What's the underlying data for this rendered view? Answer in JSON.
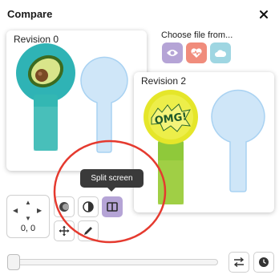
{
  "window": {
    "title": "Compare",
    "close_icon": "close-icon"
  },
  "revisions": [
    {
      "label": "Revision 0"
    },
    {
      "label": "Revision 2"
    }
  ],
  "source_picker": {
    "label": "Choose file from...",
    "buttons": [
      {
        "icon": "eye-icon",
        "color": "#b5a4d6"
      },
      {
        "icon": "heart-pulse-icon",
        "color": "#f08c7c"
      },
      {
        "icon": "cloud-icon",
        "color": "#9fd6e2"
      }
    ]
  },
  "position": {
    "coords": "0, 0"
  },
  "tooltip": {
    "text": "Split screen"
  },
  "tools": [
    {
      "icon": "overlay-icon"
    },
    {
      "icon": "contrast-icon"
    },
    {
      "icon": "split-screen-icon",
      "active": true
    },
    {
      "icon": "move-icon"
    },
    {
      "icon": "pencil-icon"
    }
  ],
  "slider": {
    "value": 0
  },
  "bottom_buttons": [
    {
      "icon": "swap-icon"
    },
    {
      "icon": "history-icon"
    }
  ],
  "colors": {
    "accent": "#b5a4d6",
    "annotation_circle": "#e53a2f",
    "placeholder_fill": "#cfe6f8",
    "placeholder_stroke": "#a9d2f2"
  }
}
